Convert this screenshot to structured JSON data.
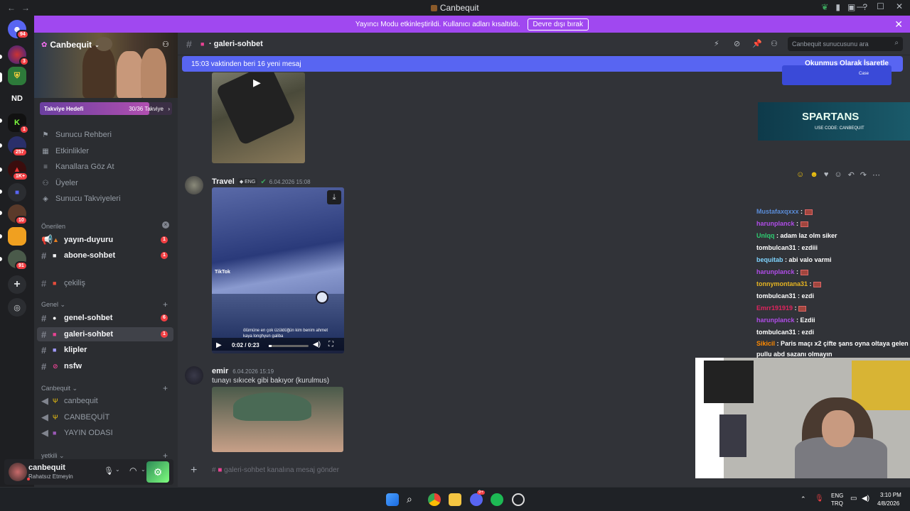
{
  "titlebar": {
    "back": "←",
    "forward": "→",
    "title": "Canbequit",
    "window_controls": [
      "—",
      "☐",
      "✕"
    ]
  },
  "banner": {
    "message": "Yayıncı Modu etkinleştirildi. Kullanıcı adları kısaltıldı.",
    "button": "Devre dışı bırak",
    "close": "✕"
  },
  "servers": {
    "top_badge": "94",
    "items": [
      {
        "label": "",
        "badge": "3"
      },
      {
        "label": "",
        "badge": ""
      },
      {
        "label": "ND",
        "badge": ""
      },
      {
        "label": "",
        "badge": "1"
      },
      {
        "label": "",
        "badge": "257"
      },
      {
        "label": "",
        "badge": "1K+"
      },
      {
        "label": "",
        "badge": ""
      },
      {
        "label": "",
        "badge": "10"
      },
      {
        "label": "",
        "badge": ""
      },
      {
        "label": "",
        "badge": "91"
      }
    ],
    "add": "+"
  },
  "sidebar": {
    "server_name": "Canbequit",
    "boost_label": "Takviye Hedefi",
    "boost_count": "30/36 Takviye",
    "boost_progress": 0.83,
    "menu": [
      "Sunucu Rehberi",
      "Etkinlikler",
      "Kanallara Göz At",
      "Üyeler",
      "Sunucu Takviyeleri"
    ],
    "section_suggested": "Önerilen",
    "suggested": [
      {
        "name": "yayın-duyuru",
        "badge": "1"
      },
      {
        "name": "abone-sohbet",
        "badge": "1"
      },
      {
        "name": "çekiliş",
        "badge": ""
      }
    ],
    "section_general": "Genel",
    "general": [
      {
        "name": "genel-sohbet",
        "badge": "6"
      },
      {
        "name": "galeri-sohbet",
        "badge": "1"
      },
      {
        "name": "klipler",
        "badge": ""
      },
      {
        "name": "nsfw",
        "badge": ""
      }
    ],
    "section_canbequit": "Canbequit",
    "canbequit": [
      {
        "name": "canbequit"
      },
      {
        "name": "CANBEQUİT"
      },
      {
        "name": "YAYIN ODASI"
      }
    ],
    "section_yetkili": "yetkili"
  },
  "user": {
    "name": "canbequit",
    "status": "Rahatsız Etmeyin"
  },
  "main": {
    "channel": "galeri-sohbet",
    "search_placeholder": "Canbequit sunucusunu ara",
    "new_messages": "15:03 vaktinden beri 16 yeni mesaj",
    "mark_read": "Okunmuş Olarak İşaretle",
    "msg1": {
      "author": "Travel",
      "tag": "ENG",
      "time": "6.04.2026 15:08",
      "video_time": "0:02 / 0:23",
      "tiktok": "TikTok",
      "caption": "ölümüne en çok üzüldüğün kim benim ahmet kaya longhyun galiba"
    },
    "msg2": {
      "author": "emir",
      "time": "6.04.2026 15:19",
      "text": "tunayı sıkıcek gibi bakıyor (kurulmus)"
    },
    "composer_placeholder": "galeri-sohbet kanalına mesaj gönder"
  },
  "overlay": {
    "sponsor": "SPARTANS",
    "sponsor_sub": "USE CODE: CANBEQUIT",
    "casino_tag": "Case"
  },
  "chat": [
    {
      "user": "Mustafaxqxxx",
      "color": "#5b8dd9",
      "text": "",
      "emote": true
    },
    {
      "user": "harunplanck",
      "color": "#b04de8",
      "text": "",
      "emote": true
    },
    {
      "user": "Unlqq",
      "color": "#2ecc71",
      "text": "adam laz olm siker",
      "emote": false
    },
    {
      "user": "tombulcan31",
      "color": "#ffffff",
      "text": "ezdiii",
      "emote": false
    },
    {
      "user": "bequitab",
      "color": "#7fd4ff",
      "text": "abi valo varmi",
      "emote": false
    },
    {
      "user": "harunplanck",
      "color": "#b04de8",
      "text": "",
      "emote": true
    },
    {
      "user": "tonnymontana31",
      "color": "#e6b422",
      "text": "",
      "emote": true
    },
    {
      "user": "tombulcan31",
      "color": "#ffffff",
      "text": "ezdi",
      "emote": false
    },
    {
      "user": "Emrr191919",
      "color": "#e0245e",
      "text": "",
      "emote": true
    },
    {
      "user": "harunplanck",
      "color": "#b04de8",
      "text": "Ezdii",
      "emote": false
    },
    {
      "user": "tombulcan31",
      "color": "#ffffff",
      "text": "ezdi",
      "emote": false
    },
    {
      "user": "Sikicil",
      "color": "#ff8a00",
      "text": "Paris maçı x2 çifte şans oyna oltaya gelen pullu abd sazanı olmayın",
      "emote": false
    }
  ],
  "taskbar": {
    "lang1": "ENG",
    "lang2": "TRQ",
    "time": "3:10 PM",
    "date": "4/8/2026",
    "discord_badge": "9+"
  }
}
